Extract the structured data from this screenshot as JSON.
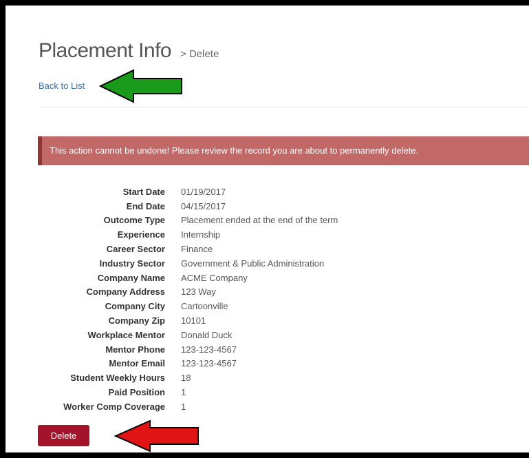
{
  "header": {
    "title": "Placement Info",
    "subtitle": "> Delete"
  },
  "nav": {
    "back_label": "Back to List"
  },
  "alert": {
    "message": "This action cannot be undone! Please review the record you are about to permanently delete."
  },
  "record": {
    "fields": [
      {
        "label": "Start Date",
        "value": "01/19/2017"
      },
      {
        "label": "End Date",
        "value": "04/15/2017"
      },
      {
        "label": "Outcome Type",
        "value": "Placement ended at the end of the term"
      },
      {
        "label": "Experience",
        "value": "Internship"
      },
      {
        "label": "Career Sector",
        "value": "Finance"
      },
      {
        "label": "Industry Sector",
        "value": "Government & Public Administration"
      },
      {
        "label": "Company Name",
        "value": "ACME Company"
      },
      {
        "label": "Company Address",
        "value": "123 Way"
      },
      {
        "label": "Company City",
        "value": "Cartoonville"
      },
      {
        "label": "Company Zip",
        "value": "10101"
      },
      {
        "label": "Workplace Mentor",
        "value": "Donald Duck"
      },
      {
        "label": "Mentor Phone",
        "value": "123-123-4567"
      },
      {
        "label": "Mentor Email",
        "value": "123-123-4567"
      },
      {
        "label": "Student Weekly Hours",
        "value": "18"
      },
      {
        "label": "Paid Position",
        "value": "1"
      },
      {
        "label": "Worker Comp Coverage",
        "value": "1"
      }
    ]
  },
  "actions": {
    "delete_label": "Delete"
  },
  "annotations": {
    "back_arrow_color": "#1a9a1a",
    "delete_arrow_color": "#e01414"
  },
  "colors": {
    "link": "#3a6fa8",
    "alert_bg": "#c26968",
    "alert_border": "#8d3634",
    "delete_button": "#a3132a"
  }
}
